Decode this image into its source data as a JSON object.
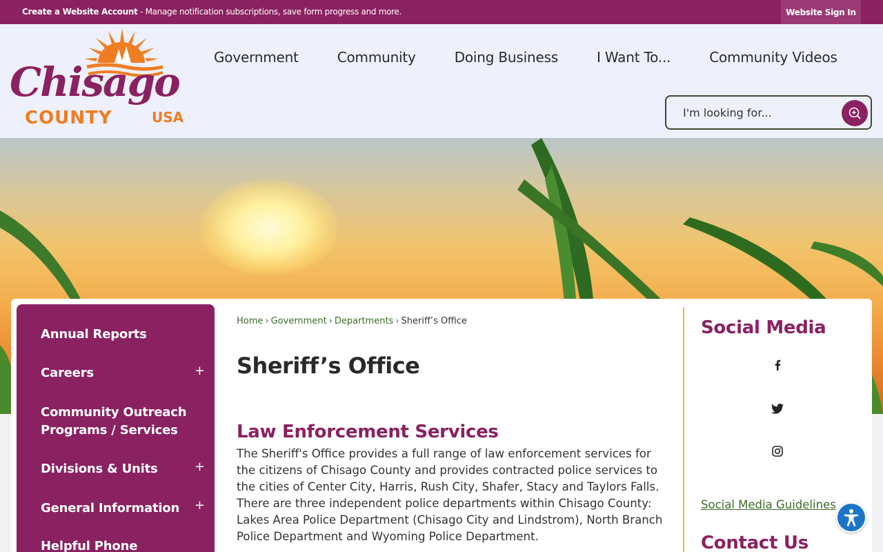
{
  "topbar": {
    "account_bold": "Create a Website Account",
    "account_text": " - Manage notification subscriptions, save form progress and more.",
    "signin": "Website Sign In"
  },
  "logo": {
    "line1": "Chisago",
    "line2": "COUNTY",
    "line3": "USA"
  },
  "nav": {
    "items": [
      "Government",
      "Community",
      "Doing Business",
      "I Want To...",
      "Community Videos"
    ]
  },
  "search": {
    "placeholder": "I'm looking for..."
  },
  "sidebar": {
    "items": [
      {
        "label": "Annual Reports",
        "expandable": false
      },
      {
        "label": "Careers",
        "expandable": true
      },
      {
        "label": "Community Outreach Programs / Services",
        "expandable": false
      },
      {
        "label": "Divisions & Units",
        "expandable": true
      },
      {
        "label": "General Information",
        "expandable": true
      },
      {
        "label": "Helpful Phone",
        "expandable": false
      }
    ],
    "expand_symbol": "+"
  },
  "breadcrumb": {
    "items": [
      "Home",
      "Government",
      "Departments",
      "Sheriff’s Office"
    ],
    "separator": "›"
  },
  "main": {
    "title": "Sheriff’s Office",
    "section_title": "Law Enforcement Services",
    "paragraph": "The Sheriff's Office provides a full range of law enforcement services for the citizens of Chisago County and provides contracted police services to the cities of Center City, Harris, Rush City, Shafer, Stacy and Taylors Falls. There are three independent police departments within Chisago County: Lakes Area Police Department (Chisago City and Lindstrom), North Branch Police Department and Wyoming Police Department."
  },
  "right": {
    "social_title": "Social Media",
    "social_icons": [
      "facebook-icon",
      "twitter-icon",
      "instagram-icon"
    ],
    "guidelines": "Social Media Guidelines",
    "contact_title": "Contact Us"
  },
  "colors": {
    "brand": "#8a2160",
    "accent_orange": "#ef7d22",
    "link_green": "#3d6b2a",
    "divider_gold": "#e6b93c"
  }
}
